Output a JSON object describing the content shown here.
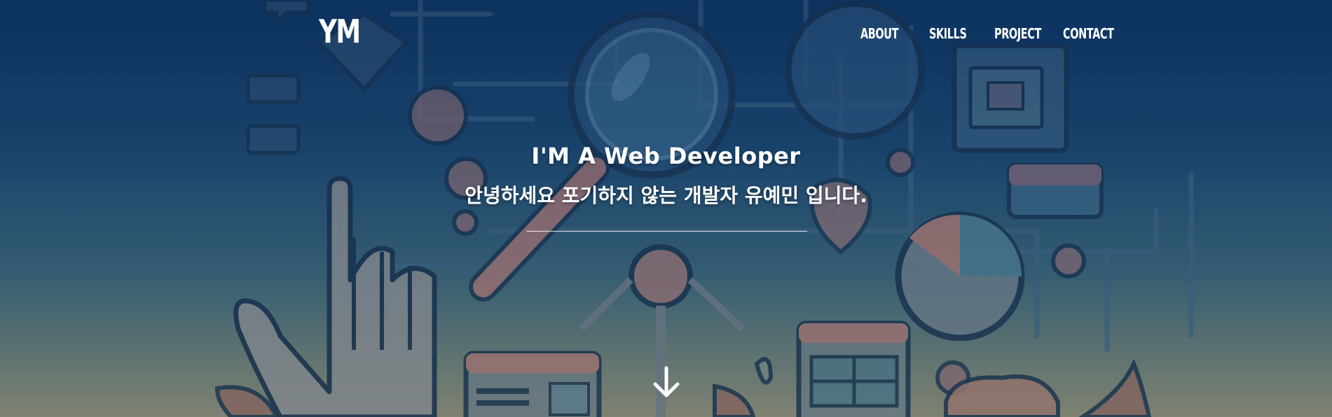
{
  "header": {
    "logo": "YM",
    "nav": [
      {
        "label": "ABOUT"
      },
      {
        "label": "SKILLS"
      },
      {
        "label": "PROJECT"
      },
      {
        "label": "CONTACT"
      }
    ]
  },
  "hero": {
    "title": "I'M A Web Developer",
    "subtitle": "안녕하세요 포기하지 않는 개발자 유예민 입니다.",
    "scroll_icon": "arrow-down-icon"
  },
  "colors": {
    "text": "#ffffff",
    "background_top": "#0e3868",
    "background_bottom": "#8a8a78"
  }
}
